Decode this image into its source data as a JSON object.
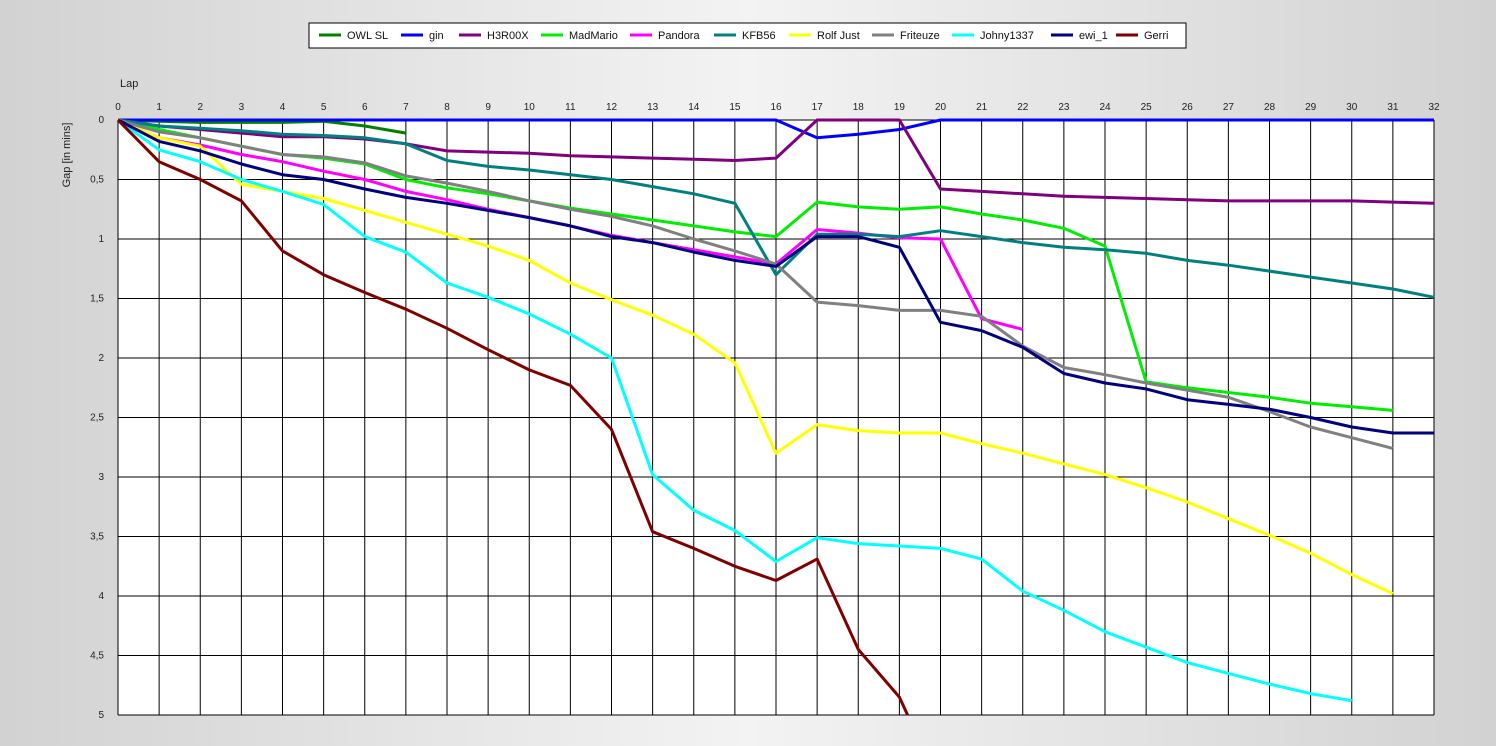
{
  "chart_data": {
    "type": "line",
    "xlabel": "Lap",
    "ylabel": "Gap [in mins]",
    "xlim": [
      0,
      32
    ],
    "ylim": [
      0,
      5
    ],
    "y_inverted": true,
    "grid": true,
    "legend_placement": "top-center",
    "x_ticks": [
      "0",
      "1",
      "2",
      "3",
      "4",
      "5",
      "6",
      "7",
      "8",
      "9",
      "10",
      "11",
      "12",
      "13",
      "14",
      "15",
      "16",
      "17",
      "18",
      "19",
      "20",
      "21",
      "22",
      "23",
      "24",
      "25",
      "26",
      "27",
      "28",
      "29",
      "30",
      "31",
      "32"
    ],
    "y_ticks": [
      {
        "value": 0,
        "label": "0"
      },
      {
        "value": 0.5,
        "label": "0,5"
      },
      {
        "value": 1,
        "label": "1"
      },
      {
        "value": 1.5,
        "label": "1,5"
      },
      {
        "value": 2,
        "label": "2"
      },
      {
        "value": 2.5,
        "label": "2,5"
      },
      {
        "value": 3,
        "label": "3"
      },
      {
        "value": 3.5,
        "label": "3,5"
      },
      {
        "value": 4,
        "label": "4"
      },
      {
        "value": 4.5,
        "label": "4,5"
      },
      {
        "value": 5,
        "label": "5"
      }
    ],
    "series": [
      {
        "name": "OWL SL",
        "color": "#008000",
        "x": [
          0,
          1,
          2,
          3,
          4,
          5,
          6,
          7
        ],
        "values": [
          0,
          0.01,
          0.02,
          0.02,
          0.02,
          0.01,
          0.05,
          0.11
        ]
      },
      {
        "name": "gin",
        "color": "#0000ff",
        "x": [
          0,
          1,
          2,
          3,
          4,
          5,
          6,
          7,
          8,
          9,
          10,
          11,
          12,
          13,
          14,
          15,
          16,
          17,
          18,
          19,
          20,
          21,
          22,
          23,
          24,
          25,
          26,
          27,
          28,
          29,
          30,
          31,
          32
        ],
        "values": [
          0,
          0,
          0,
          0,
          0,
          0,
          0,
          0,
          0,
          0,
          0,
          0,
          0,
          0,
          0,
          0,
          0,
          0.15,
          0.12,
          0.08,
          0,
          0,
          0,
          0,
          0,
          0,
          0,
          0,
          0,
          0,
          0,
          0,
          0
        ]
      },
      {
        "name": "H3R00X",
        "color": "#800080",
        "x": [
          0,
          1,
          2,
          3,
          4,
          5,
          6,
          7,
          8,
          9,
          10,
          11,
          12,
          13,
          14,
          15,
          16,
          17,
          18,
          19,
          20,
          21,
          22,
          23,
          24,
          25,
          26,
          27,
          28,
          29,
          30,
          31,
          32
        ],
        "values": [
          0,
          0.05,
          0.08,
          0.11,
          0.14,
          0.14,
          0.16,
          0.2,
          0.26,
          0.27,
          0.28,
          0.3,
          0.31,
          0.32,
          0.33,
          0.34,
          0.32,
          0,
          0,
          0,
          0.58,
          0.6,
          0.62,
          0.64,
          0.65,
          0.66,
          0.67,
          0.68,
          0.68,
          0.68,
          0.68,
          0.69,
          0.7
        ]
      },
      {
        "name": "MadMario",
        "color": "#00ee00",
        "x": [
          0,
          1,
          2,
          3,
          4,
          5,
          6,
          7,
          8,
          9,
          10,
          11,
          12,
          13,
          14,
          15,
          16,
          17,
          18,
          19,
          20,
          21,
          22,
          23,
          24,
          25,
          26,
          27,
          28,
          29,
          30,
          31
        ],
        "values": [
          0,
          0.08,
          0.15,
          0.22,
          0.29,
          0.32,
          0.37,
          0.5,
          0.57,
          0.62,
          0.68,
          0.74,
          0.79,
          0.84,
          0.89,
          0.94,
          0.98,
          0.69,
          0.73,
          0.75,
          0.73,
          0.79,
          0.84,
          0.91,
          1.06,
          2.2,
          2.25,
          2.29,
          2.33,
          2.38,
          2.41,
          2.44
        ]
      },
      {
        "name": "Pandora",
        "color": "#ff00ff",
        "x": [
          0,
          1,
          2,
          3,
          4,
          5,
          6,
          7,
          8,
          9,
          10,
          11,
          12,
          13,
          14,
          15,
          16,
          17,
          18,
          19,
          20,
          21,
          22
        ],
        "values": [
          0,
          0.15,
          0.21,
          0.29,
          0.35,
          0.43,
          0.5,
          0.6,
          0.67,
          0.75,
          0.82,
          0.89,
          0.97,
          1.03,
          1.09,
          1.15,
          1.21,
          0.92,
          0.95,
          0.99,
          1,
          1.67,
          1.76
        ]
      },
      {
        "name": "KFB56",
        "color": "#008080",
        "x": [
          0,
          1,
          2,
          3,
          4,
          5,
          6,
          7,
          8,
          9,
          10,
          11,
          12,
          13,
          14,
          15,
          16,
          17,
          18,
          19,
          20,
          21,
          22,
          23,
          24,
          25,
          26,
          27,
          28,
          29,
          30,
          31,
          32
        ],
        "values": [
          0,
          0.05,
          0.07,
          0.09,
          0.12,
          0.13,
          0.15,
          0.2,
          0.34,
          0.39,
          0.42,
          0.46,
          0.5,
          0.56,
          0.62,
          0.7,
          1.3,
          0.96,
          0.96,
          0.98,
          0.93,
          0.98,
          1.03,
          1.07,
          1.09,
          1.12,
          1.18,
          1.22,
          1.27,
          1.32,
          1.37,
          1.42,
          1.49
        ]
      },
      {
        "name": "Rolf Just",
        "color": "#ffff00",
        "x": [
          0,
          1,
          2,
          3,
          4,
          5,
          6,
          7,
          8,
          9,
          10,
          11,
          12,
          13,
          14,
          15,
          16,
          17,
          18,
          19,
          20,
          21,
          22,
          23,
          24,
          25,
          26,
          27,
          28,
          29,
          30,
          31
        ],
        "values": [
          0,
          0.15,
          0.22,
          0.54,
          0.6,
          0.66,
          0.76,
          0.86,
          0.96,
          1.06,
          1.18,
          1.37,
          1.51,
          1.64,
          1.8,
          2.04,
          2.8,
          2.56,
          2.61,
          2.63,
          2.63,
          2.72,
          2.8,
          2.89,
          2.98,
          3.09,
          3.21,
          3.35,
          3.49,
          3.64,
          3.82,
          3.98
        ]
      },
      {
        "name": "Friteuze",
        "color": "#808080",
        "x": [
          0,
          1,
          2,
          3,
          4,
          5,
          6,
          7,
          8,
          9,
          10,
          11,
          12,
          13,
          14,
          15,
          16,
          17,
          18,
          19,
          20,
          21,
          22,
          23,
          24,
          25,
          26,
          27,
          28,
          29,
          30,
          31
        ],
        "values": [
          0,
          0.1,
          0.15,
          0.22,
          0.29,
          0.31,
          0.36,
          0.47,
          0.53,
          0.6,
          0.68,
          0.75,
          0.81,
          0.89,
          1,
          1.1,
          1.21,
          1.53,
          1.56,
          1.6,
          1.6,
          1.65,
          1.9,
          2.08,
          2.14,
          2.21,
          2.27,
          2.33,
          2.45,
          2.58,
          2.67,
          2.76
        ]
      },
      {
        "name": "Johny1337",
        "color": "#00ffff",
        "x": [
          0,
          1,
          2,
          3,
          4,
          5,
          6,
          7,
          8,
          9,
          10,
          11,
          12,
          13,
          14,
          15,
          16,
          17,
          18,
          19,
          20,
          21,
          22,
          23,
          24,
          25,
          26,
          27,
          28,
          29,
          30
        ],
        "values": [
          0,
          0.25,
          0.35,
          0.5,
          0.6,
          0.71,
          0.98,
          1.11,
          1.37,
          1.49,
          1.63,
          1.8,
          2,
          2.98,
          3.28,
          3.45,
          3.71,
          3.51,
          3.56,
          3.58,
          3.6,
          3.69,
          3.96,
          4.12,
          4.3,
          4.43,
          4.56,
          4.65,
          4.74,
          4.82,
          4.88
        ]
      },
      {
        "name": "ewi_1",
        "color": "#000080",
        "x": [
          0,
          1,
          2,
          3,
          4,
          5,
          6,
          7,
          8,
          9,
          10,
          11,
          12,
          13,
          14,
          15,
          16,
          17,
          18,
          19,
          20,
          21,
          22,
          23,
          24,
          25,
          26,
          27,
          28,
          29,
          30,
          31,
          32
        ],
        "values": [
          0,
          0.18,
          0.26,
          0.37,
          0.46,
          0.5,
          0.58,
          0.65,
          0.7,
          0.76,
          0.82,
          0.89,
          0.98,
          1.03,
          1.11,
          1.18,
          1.23,
          0.98,
          0.98,
          1.07,
          1.7,
          1.77,
          1.91,
          2.13,
          2.21,
          2.26,
          2.35,
          2.39,
          2.43,
          2.5,
          2.58,
          2.63,
          2.63
        ]
      },
      {
        "name": "Gerri",
        "color": "#800000",
        "x": [
          0,
          1,
          2,
          3,
          4,
          5,
          6,
          7,
          8,
          9,
          10,
          11,
          12,
          13,
          14,
          15,
          16,
          17,
          18,
          19,
          19.2
        ],
        "values": [
          0,
          0.35,
          0.5,
          0.68,
          1.1,
          1.3,
          1.45,
          1.59,
          1.75,
          1.93,
          2.1,
          2.23,
          2.6,
          3.46,
          3.6,
          3.75,
          3.87,
          3.69,
          4.45,
          4.85,
          5
        ]
      }
    ]
  }
}
